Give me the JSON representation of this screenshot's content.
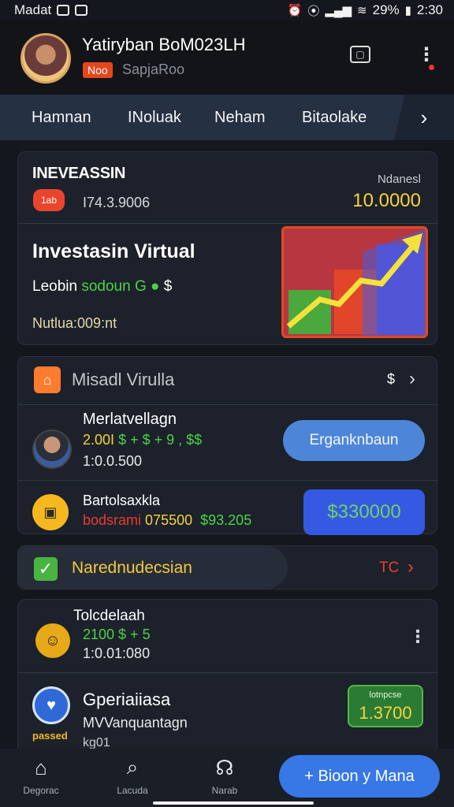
{
  "status_bar": {
    "left_text": "Madat",
    "battery": "29%",
    "time": "2:30"
  },
  "profile": {
    "name": "Yatiryban BoM023LH",
    "tag": "Noo",
    "subtitle": "SapjaRoo"
  },
  "tabs": [
    "Hamnan",
    "INoluak",
    "Neham",
    "Bitaolake"
  ],
  "investment": {
    "header": "INEVEASSIN",
    "chat_badge": "1ab",
    "number": "I74.3.9006",
    "right_label": "Ndanesl",
    "right_value": "10.0000",
    "title": "Investasin Virtual",
    "line1_prefix": "Leobin",
    "line1_green": "sodoun G",
    "line1_suffix": "$",
    "line2": "Nutlua:009:nt"
  },
  "mission": {
    "title": "Misadl Virulla",
    "dollar": "$",
    "row1": {
      "title": "Merlatvellagn",
      "nums_yellow": "2.00I",
      "nums_green": "$ + $ + 9 , $$",
      "sub": "1:0.0.500",
      "button": "Erganknbaun"
    },
    "row2": {
      "title": "Bartolsaxkla",
      "red": "bodsrami",
      "yellow": "075500",
      "green": "$93.205",
      "button": "$330000"
    }
  },
  "narrow": {
    "text": "Narednudecsian",
    "tc": "TC"
  },
  "list": {
    "item1": {
      "title": "Tolcdelaah",
      "nums": "2100 $ + 5",
      "sub": "1:0.01:080"
    },
    "item2": {
      "title": "Gperiaiiasa",
      "sub": "MVVanquantagn",
      "sub2": "kg01",
      "badge": "passed",
      "tag_label": "lotnpcse",
      "tag_value": "1.3700"
    }
  },
  "bottom_nav": {
    "items": [
      "Degorac",
      "Lacuda",
      "Narab"
    ],
    "fab": "+ Bioon y Mana"
  },
  "colors": {
    "background": "#14171d",
    "accent_blue": "#3777e6",
    "accent_yellow": "#f7d23b",
    "accent_green": "#4dd246",
    "accent_red": "#e8432f"
  }
}
